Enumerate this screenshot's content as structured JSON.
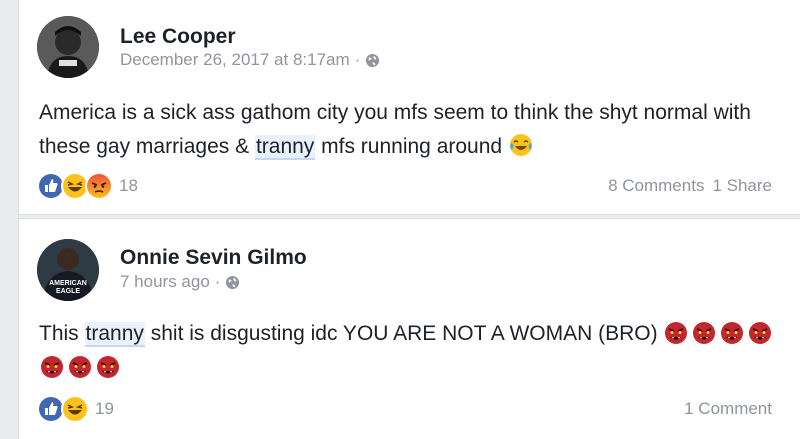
{
  "posts": [
    {
      "author": "Lee Cooper",
      "timestamp": "December 26, 2017 at 8:17am",
      "separator": "·",
      "privacy_icon": "globe-icon",
      "text_parts": [
        "America is a sick ass gathom city you mfs seem to think the shyt normal with these gay marriages & ",
        "tranny",
        " mfs running around"
      ],
      "trailing_emoji": "tears-of-joy-emoji",
      "reactions": [
        "like",
        "haha",
        "angry"
      ],
      "reaction_count": "18",
      "comments": "8 Comments",
      "shares": "1 Share"
    },
    {
      "author": "Onnie Sevin Gilmo",
      "timestamp": "7 hours ago",
      "separator": "·",
      "privacy_icon": "globe-icon",
      "text_parts": [
        "This ",
        "tranny",
        " shit is disgusting idc YOU ARE NOT A WOMAN (BRO)"
      ],
      "trailing_emoji": "japanese-ogre-emoji",
      "trailing_emoji_count": 7,
      "avatar_text": [
        "AMERICAN",
        "EAGLE"
      ],
      "reactions": [
        "like",
        "haha"
      ],
      "reaction_count": "19",
      "comments": "1 Comment"
    }
  ],
  "colors": {
    "background": "#e9ebee",
    "meta_text": "#90949c",
    "like_blue": "#3b5998",
    "tag_highlight": "#e9f1fd"
  }
}
